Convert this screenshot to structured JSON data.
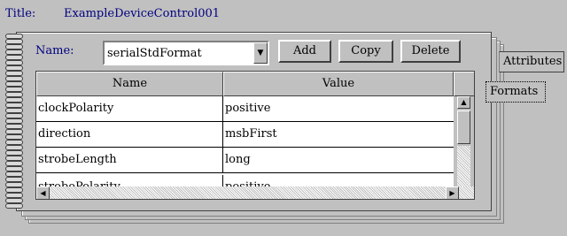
{
  "header": {
    "title_label": "Title:",
    "title_value": "ExampleDeviceControl001"
  },
  "tabs": [
    {
      "label": "Attributes"
    },
    {
      "label": "Formats"
    }
  ],
  "form": {
    "name_label": "Name:",
    "name_value": "serialStdFormat"
  },
  "buttons": {
    "add": "Add",
    "copy": "Copy",
    "delete": "Delete"
  },
  "table": {
    "columns": [
      "Name",
      "Value"
    ],
    "rows": [
      {
        "name": "clockPolarity",
        "value": "positive"
      },
      {
        "name": "direction",
        "value": "msbFirst"
      },
      {
        "name": "strobeLength",
        "value": "long"
      },
      {
        "name": "strobePolarity",
        "value": "positive"
      }
    ]
  },
  "icons": {
    "combo_arrow": "chevron-down-icon",
    "scroll_up": "arrow-up-icon",
    "scroll_left": "arrow-left-icon",
    "scroll_right": "arrow-right-icon"
  }
}
